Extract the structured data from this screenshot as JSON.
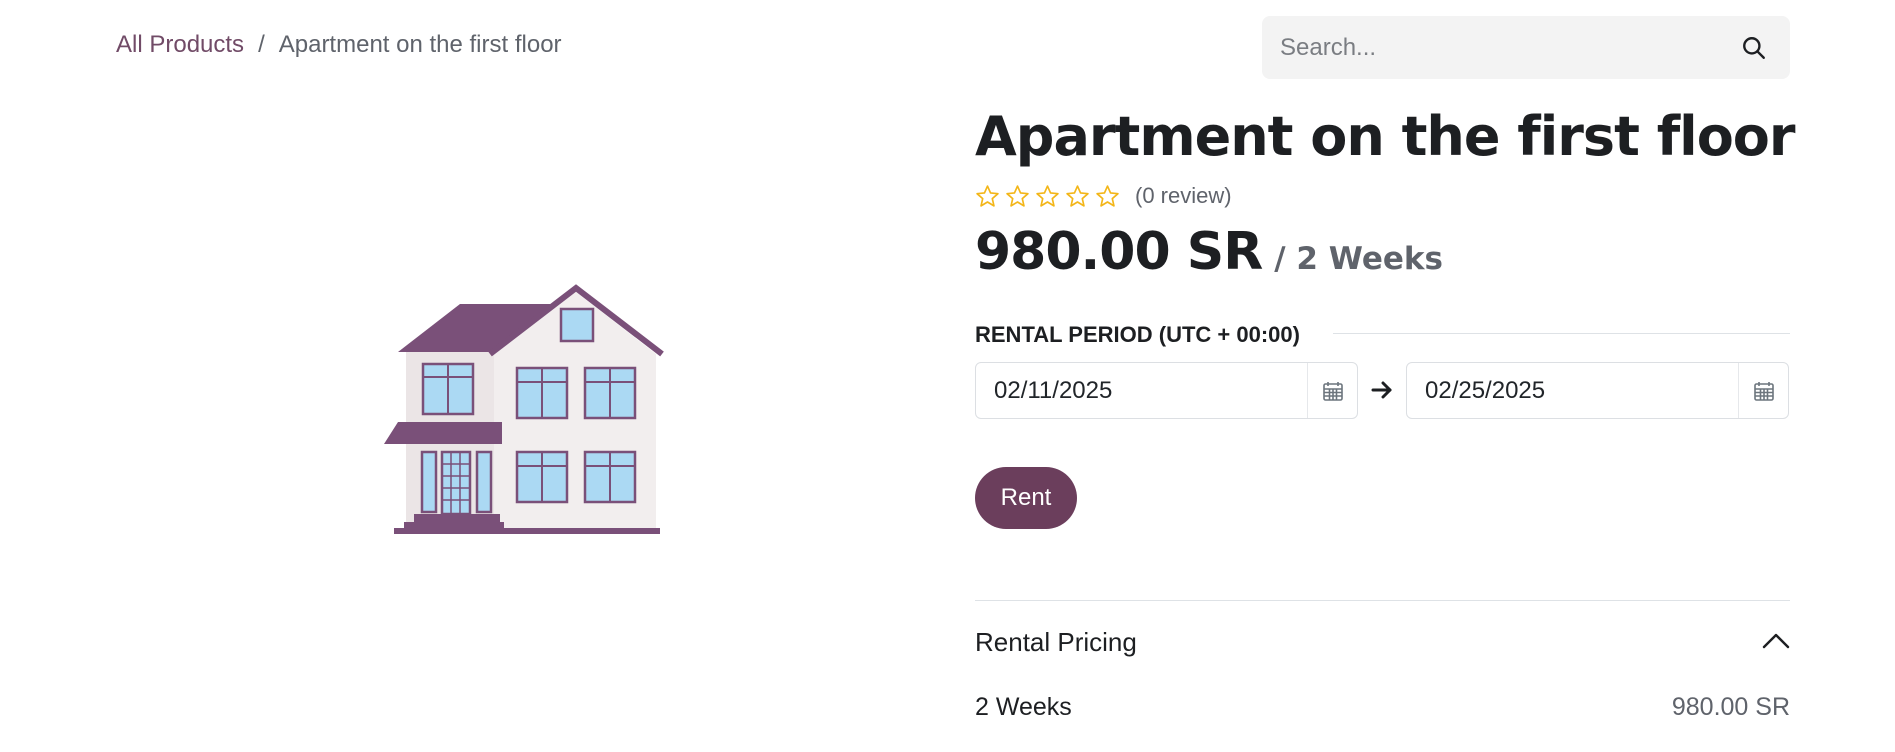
{
  "breadcrumb": {
    "parent": "All Products",
    "separator": "/",
    "current": "Apartment on the first floor"
  },
  "search": {
    "placeholder": "Search...",
    "icon": "search-icon"
  },
  "product": {
    "image_icon": "house-illustration",
    "title": "Apartment on the first floor",
    "rating": {
      "stars_filled": 0,
      "stars_total": 5,
      "review_count_text": "(0 review)"
    },
    "price": {
      "amount": "980.00 SR",
      "unit": "/ 2 Weeks"
    }
  },
  "rental_period": {
    "label": "RENTAL PERIOD (UTC + 00:00)",
    "start_date": "02/11/2025",
    "end_date": "02/25/2025",
    "calendar_icon": "calendar-icon",
    "arrow_icon": "arrow-right-icon"
  },
  "actions": {
    "rent_label": "Rent"
  },
  "pricing": {
    "title": "Rental Pricing",
    "toggle_icon": "chevron-up-icon",
    "rows": [
      {
        "duration": "2 Weeks",
        "price": "980.00 SR"
      }
    ]
  },
  "colors": {
    "brand": "#714b67",
    "button": "#6b3e5c",
    "star": "#f3b619",
    "search_bg": "#f3f3f3"
  }
}
